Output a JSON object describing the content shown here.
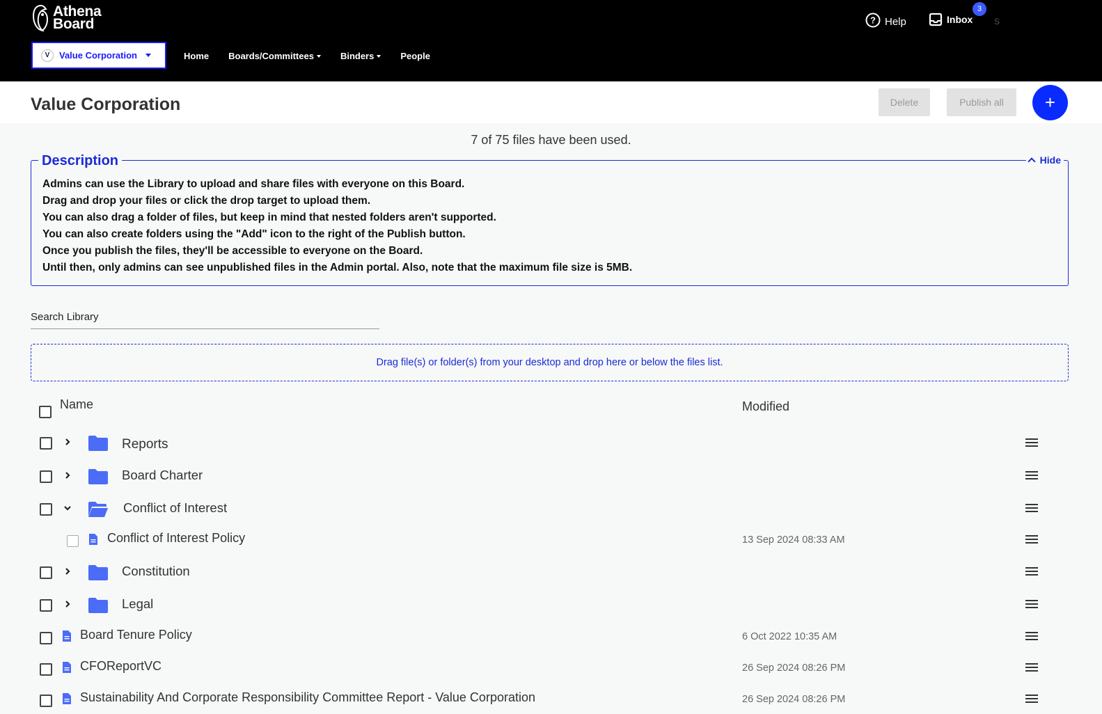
{
  "brand": {
    "line1": "Athena",
    "line2": "Board"
  },
  "org_selector": {
    "badge": "V",
    "label": "Value Corporation"
  },
  "nav": [
    {
      "label": "Home",
      "dropdown": false
    },
    {
      "label": "Boards/Committees",
      "dropdown": true
    },
    {
      "label": "Binders",
      "dropdown": true
    },
    {
      "label": "People",
      "dropdown": false
    }
  ],
  "topright": {
    "help": "Help",
    "inbox": "Inbox",
    "inbox_count": "3",
    "user_initial": "S"
  },
  "page": {
    "title": "Value Corporation",
    "delete_label": "Delete",
    "publish_label": "Publish all",
    "add_label": "+",
    "usage": "7 of 75 files have been used."
  },
  "description": {
    "legend": "Description",
    "hide_label": "Hide",
    "lines": [
      "Admins can use the Library to upload and share files with everyone on this Board.",
      "Drag and drop your files or click the drop target to upload them.",
      "You can also drag a folder of files, but keep in mind that nested folders aren't supported.",
      "You can also create folders using the \"Add\" icon to the right of the Publish button.",
      "Once you publish the files, they'll be accessible to everyone on the Board.",
      "Until then, only admins can see unpublished files in the Admin portal. Also, note that the maximum file size is 5MB."
    ]
  },
  "search": {
    "label": "Search Library"
  },
  "dropzone": {
    "text": "Drag file(s) or folder(s) from your desktop and drop here or below the files list."
  },
  "files": {
    "col_name": "Name",
    "col_modified": "Modified",
    "rows": [
      {
        "name": "Reports",
        "type": "folder",
        "expanded": false,
        "modified": ""
      },
      {
        "name": "Board Charter",
        "type": "folder",
        "expanded": false,
        "modified": ""
      },
      {
        "name": "Conflict of Interest",
        "type": "folder",
        "expanded": true,
        "modified": ""
      },
      {
        "name": "Conflict of Interest Policy",
        "type": "file",
        "child": true,
        "modified": "13 Sep 2024 08:33 AM"
      },
      {
        "name": "Constitution",
        "type": "folder",
        "expanded": false,
        "modified": ""
      },
      {
        "name": "Legal",
        "type": "folder",
        "expanded": false,
        "modified": ""
      },
      {
        "name": "Board Tenure Policy",
        "type": "file",
        "modified": "6 Oct 2022 10:35 AM"
      },
      {
        "name": "CFOReportVC",
        "type": "file",
        "modified": "26 Sep 2024 08:26 PM"
      },
      {
        "name": "Sustainability And Corporate Responsibility Committee Report - Value Corporation",
        "type": "file",
        "modified": "26 Sep 2024 08:26 PM"
      }
    ]
  },
  "colors": {
    "accent": "#1a2bd6",
    "primary_button": "#0a2bff",
    "folder": "#4a6cf7",
    "topbar": "#000000"
  }
}
